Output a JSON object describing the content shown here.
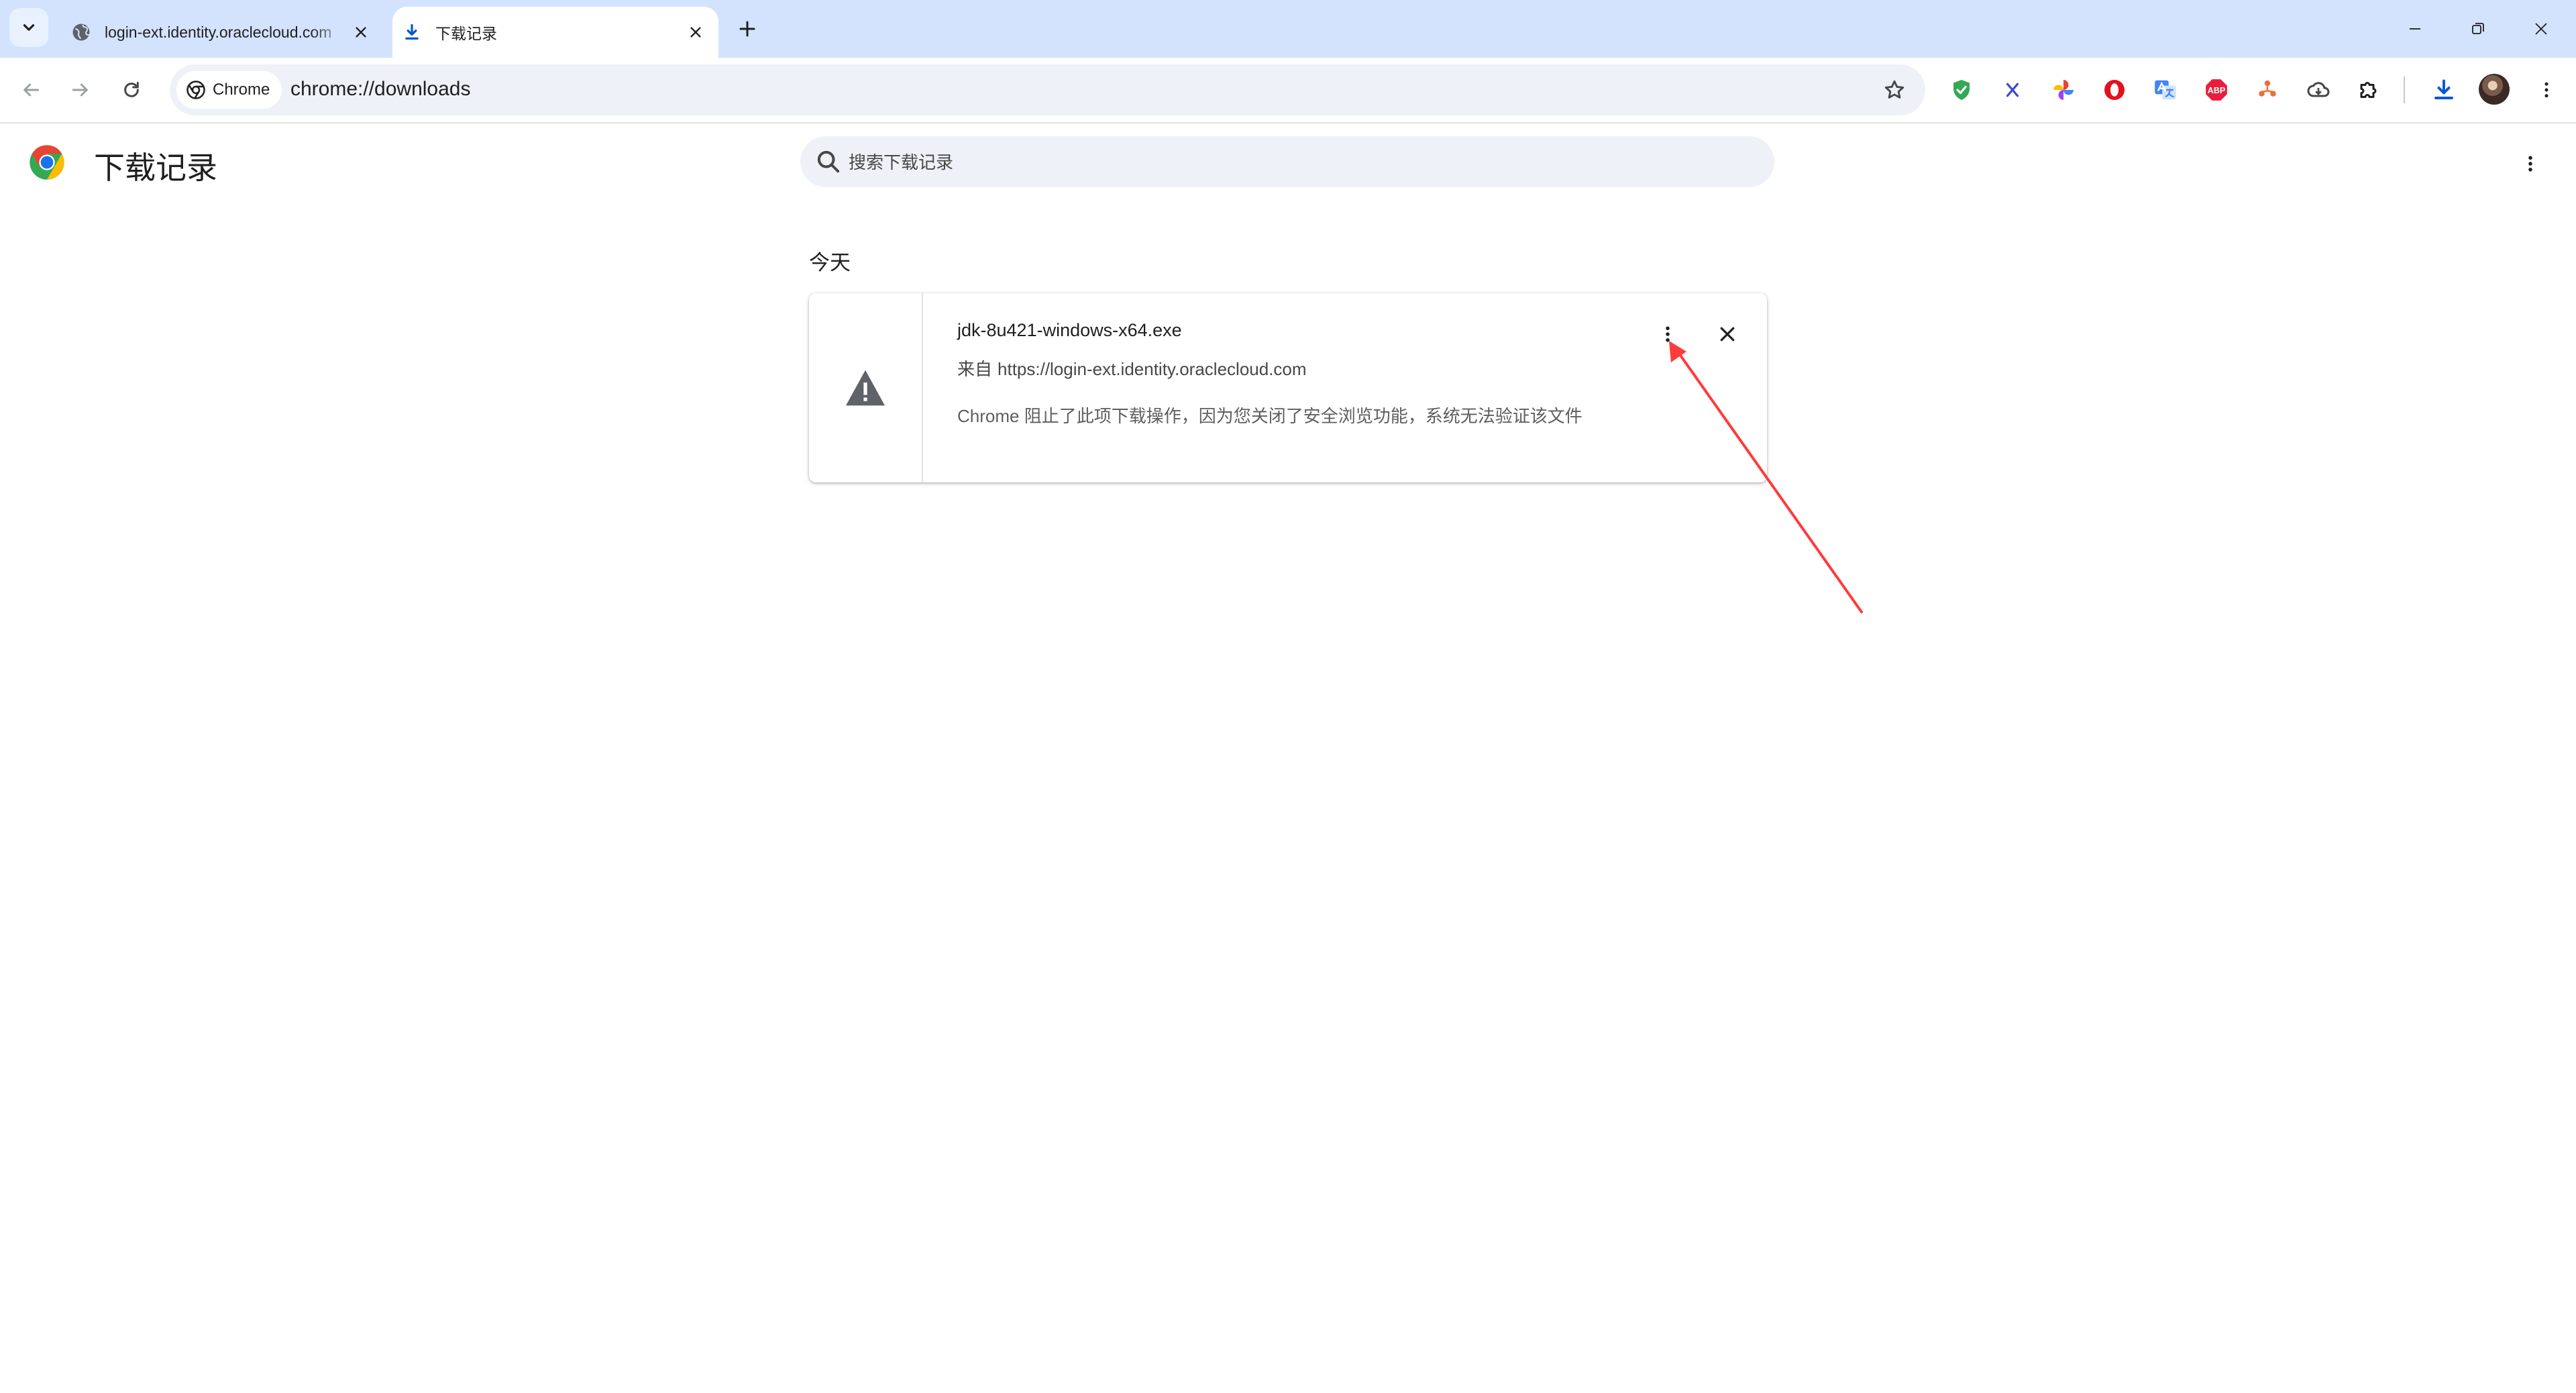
{
  "tabs": [
    {
      "title": "login-ext.identity.oraclecloud.com",
      "active": false,
      "favicon": "globe-icon"
    },
    {
      "title": "下载记录",
      "active": true,
      "favicon": "download-icon"
    }
  ],
  "toolbar": {
    "chip_label": "Chrome",
    "url": "chrome://downloads",
    "extensions": [
      "shield-check-icon",
      "x-icon",
      "pinwheel-icon",
      "opera-icon",
      "translate-icon",
      "adblock-plus-icon",
      "tree-icon",
      "cloud-icon",
      "puzzle-icon"
    ]
  },
  "page": {
    "title": "下载记录",
    "search_placeholder": "搜索下载记录"
  },
  "downloads": {
    "date_label": "今天",
    "items": [
      {
        "file_name": "jdk-8u421-windows-x64.exe",
        "source_prefix": "来自",
        "source_url": "https://login-ext.identity.oraclecloud.com",
        "description": "Chrome 阻止了此项下载操作，因为您关闭了安全浏览功能，系统无法验证该文件",
        "status_icon": "warning-icon"
      }
    ]
  },
  "colors": {
    "tabstrip_bg": "#d3e3fd",
    "omnibox_bg": "#eef1f8",
    "annotation_arrow": "#ff3b3b"
  }
}
